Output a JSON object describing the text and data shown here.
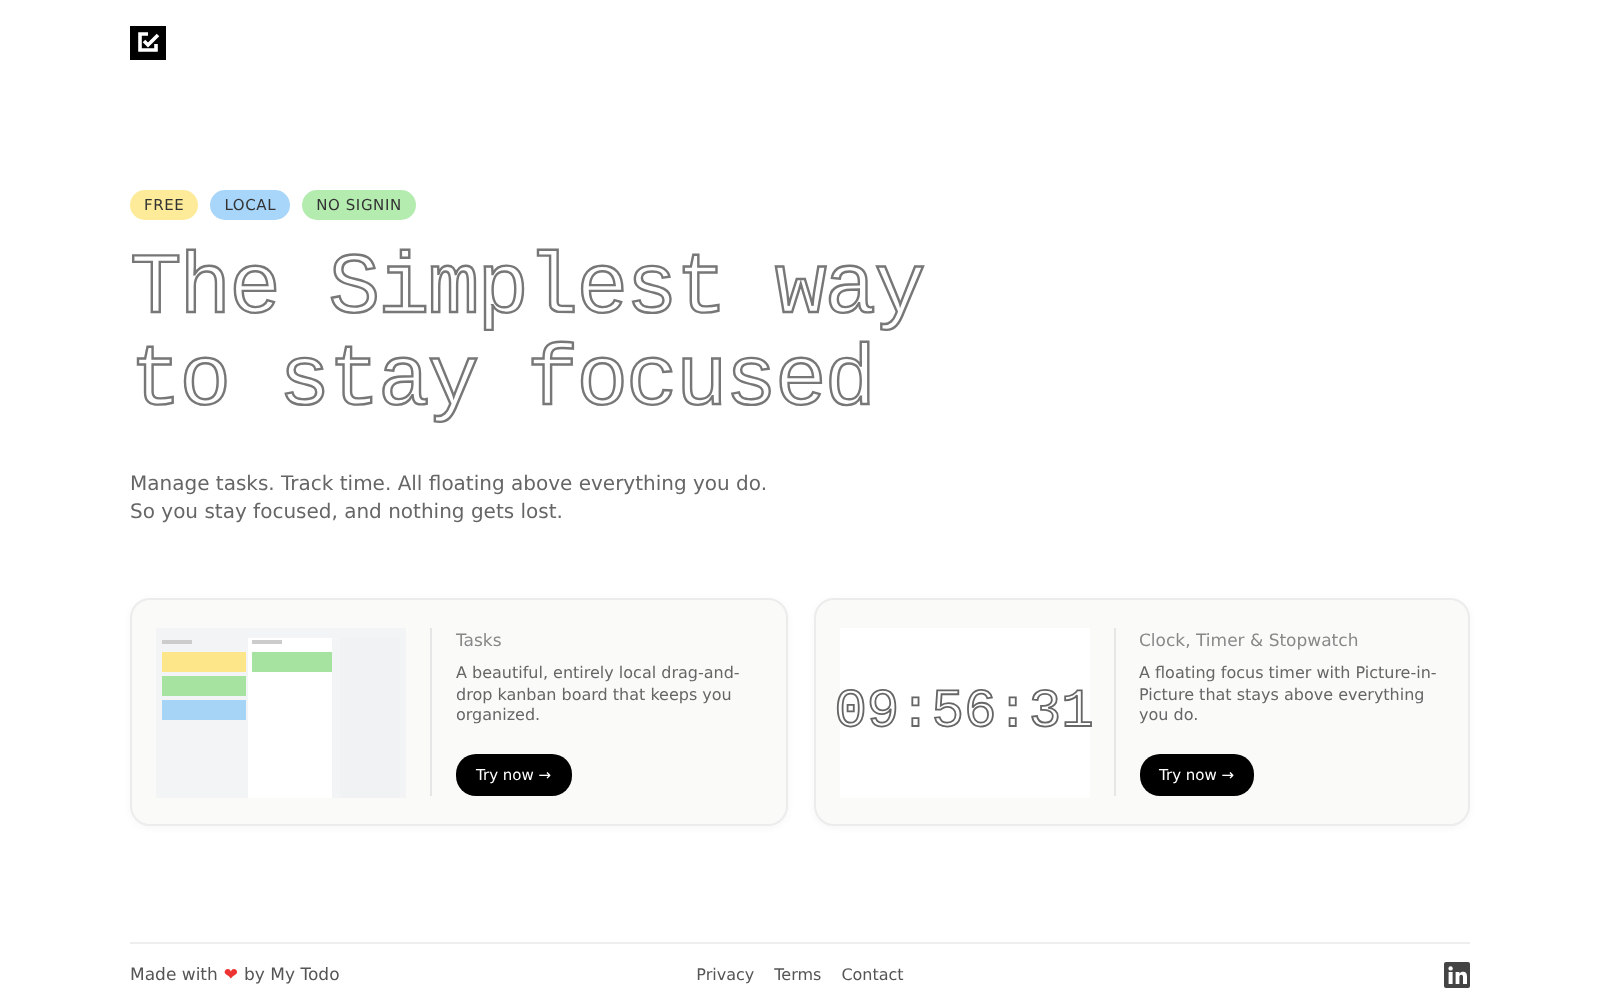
{
  "badges": [
    {
      "label": "FREE",
      "color": "#fdeb99"
    },
    {
      "label": "LOCAL",
      "color": "#a8d5fa"
    },
    {
      "label": "NO SIGNIN",
      "color": "#b4ecb0"
    }
  ],
  "headline": [
    "The Simplest way",
    "to stay focused"
  ],
  "intro": "Manage tasks. Track time. All floating above everything you do. So you stay focused, and nothing gets lost.",
  "cards": [
    {
      "kind": "kanban",
      "title": "Tasks",
      "description": "A beautiful, entirely local drag-and-drop kanban board that keeps you organized.",
      "button": "Try now →"
    },
    {
      "kind": "clock",
      "clock": "09:56:31",
      "title": "Clock, Timer & Stopwatch",
      "description": "A floating focus timer with Picture-in-Picture that stays above everything you do.",
      "button": "Try now →"
    }
  ],
  "footer": {
    "made_with": "Made with",
    "heart": "❤",
    "by": "by My Todo",
    "links": [
      "Privacy",
      "Terms",
      "Contact"
    ]
  }
}
